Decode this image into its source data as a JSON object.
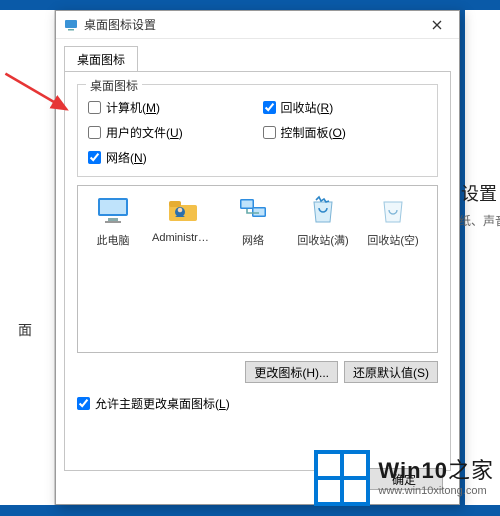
{
  "backdrop": {
    "left_text": "面",
    "right_title": "设置",
    "right_sub": "具壁纸、声音"
  },
  "dialog": {
    "title": "桌面图标设置",
    "close_label": "×",
    "tab_label": "桌面图标",
    "group_legend": "桌面图标",
    "checks": {
      "computer": {
        "label": "计算机",
        "hotkey": "M",
        "checked": false
      },
      "recycle": {
        "label": "回收站",
        "hotkey": "R",
        "checked": true
      },
      "userdocs": {
        "label": "用户的文件",
        "hotkey": "U",
        "checked": false
      },
      "cpanel": {
        "label": "控制面板",
        "hotkey": "O",
        "checked": false
      },
      "network": {
        "label": "网络",
        "hotkey": "N",
        "checked": true
      }
    },
    "icons": {
      "thispc": {
        "label": "此电脑",
        "glyph": "monitor"
      },
      "admin": {
        "label": "Administrat...",
        "glyph": "user"
      },
      "net": {
        "label": "网络",
        "glyph": "net"
      },
      "binfull": {
        "label": "回收站(满)",
        "glyph": "binfull"
      },
      "binempty": {
        "label": "回收站(空)",
        "glyph": "binempty"
      }
    },
    "change_icon_btn": "更改图标(H)...",
    "restore_btn": "还原默认值(S)",
    "allow_theme": {
      "label": "允许主题更改桌面图标",
      "hotkey": "L",
      "checked": true
    },
    "ok_btn": "确定"
  },
  "watermark": {
    "brand": "Win10",
    "brand_cn": "之家",
    "url": "www.win10xitong.com"
  }
}
